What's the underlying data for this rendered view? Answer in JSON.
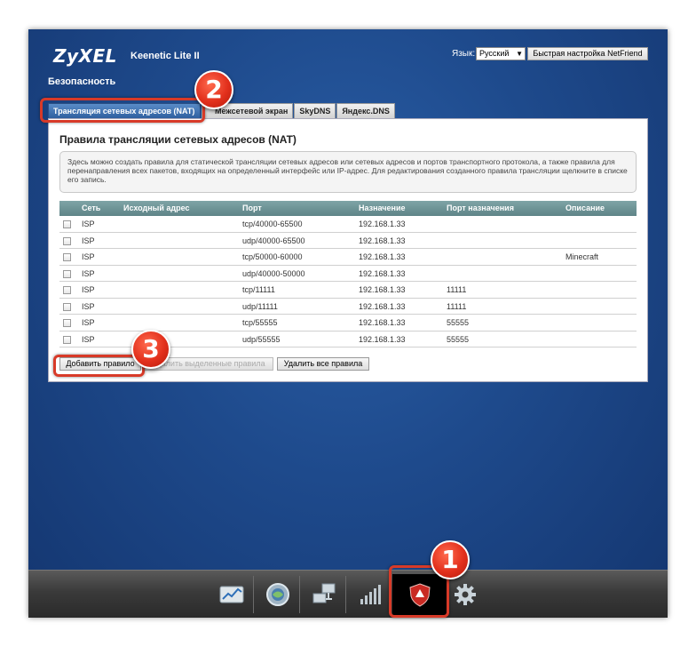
{
  "header": {
    "logo": "ZyXEL",
    "model": "Keenetic Lite II",
    "lang_label": "Язык:",
    "lang_value": "Русский",
    "quick_setup": "Быстрая настройка NetFriend"
  },
  "section_title": "Безопасность",
  "tabs": [
    {
      "label": "Трансляция сетевых адресов (NAT)",
      "active": true
    },
    {
      "label": "Межсетевой экран",
      "active": false
    },
    {
      "label": "SkyDNS",
      "active": false
    },
    {
      "label": "Яндекс.DNS",
      "active": false
    }
  ],
  "panel": {
    "title": "Правила трансляции сетевых адресов (NAT)",
    "info": "Здесь можно создать правила для статической трансляции сетевых адресов или сетевых адресов и портов транспортного протокола, а также правила для перенаправления всех пакетов, входящих на определенный интерфейс или IP-адрес. Для редактирования созданного правила трансляции щелкните в списке его запись."
  },
  "table": {
    "columns": [
      "Сеть",
      "Исходный адрес",
      "Порт",
      "Назначение",
      "Порт назначения",
      "Описание"
    ],
    "rows": [
      {
        "net": "ISP",
        "src": "",
        "port": "tcp/40000-65500",
        "dst": "192.168.1.33",
        "dport": "",
        "desc": ""
      },
      {
        "net": "ISP",
        "src": "",
        "port": "udp/40000-65500",
        "dst": "192.168.1.33",
        "dport": "",
        "desc": ""
      },
      {
        "net": "ISP",
        "src": "",
        "port": "tcp/50000-60000",
        "dst": "192.168.1.33",
        "dport": "",
        "desc": "Minecraft"
      },
      {
        "net": "ISP",
        "src": "",
        "port": "udp/40000-50000",
        "dst": "192.168.1.33",
        "dport": "",
        "desc": ""
      },
      {
        "net": "ISP",
        "src": "",
        "port": "tcp/11111",
        "dst": "192.168.1.33",
        "dport": "11111",
        "desc": ""
      },
      {
        "net": "ISP",
        "src": "",
        "port": "udp/11111",
        "dst": "192.168.1.33",
        "dport": "11111",
        "desc": ""
      },
      {
        "net": "ISP",
        "src": "",
        "port": "tcp/55555",
        "dst": "192.168.1.33",
        "dport": "55555",
        "desc": ""
      },
      {
        "net": "ISP",
        "src": "",
        "port": "udp/55555",
        "dst": "192.168.1.33",
        "dport": "55555",
        "desc": ""
      }
    ]
  },
  "buttons": {
    "add": "Добавить правило",
    "delete_selected": "Удалить выделенные правила",
    "delete_all": "Удалить все правила"
  },
  "dock": {
    "icons": [
      "chart-icon",
      "globe-icon",
      "network-icon",
      "signal-icon",
      "shield-icon",
      "gear-icon"
    ],
    "active": "shield-icon"
  },
  "annotations": {
    "badge1": "1",
    "badge2": "2",
    "badge3": "3",
    "highlight_color": "#d83a28"
  },
  "colors": {
    "background": "#1e4a8c",
    "tab_active": "#2e5f9f",
    "table_header": "#5e8487"
  }
}
